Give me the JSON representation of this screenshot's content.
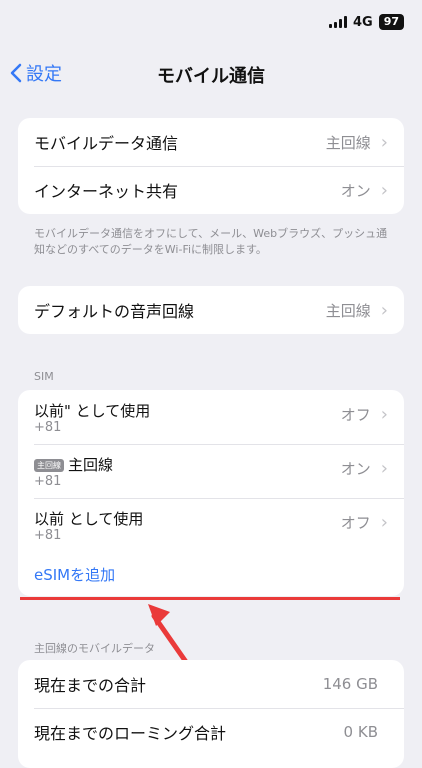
{
  "status": {
    "network": "4G",
    "battery": "97"
  },
  "nav": {
    "back_label": "設定",
    "title": "モバイル通信"
  },
  "group1": {
    "rows": [
      {
        "label": "モバイルデータ通信",
        "value": "主回線"
      },
      {
        "label": "インターネット共有",
        "value": "オン"
      }
    ],
    "note": "モバイルデータ通信をオフにして、メール、Webブラウズ、プッシュ通知などのすべてのデータをWi-Fiに制限します。"
  },
  "group2": {
    "label": "デフォルトの音声回線",
    "value": "主回線"
  },
  "sim": {
    "header": "SIM",
    "rows": [
      {
        "title": "以前\"                          として使用",
        "sub": "+81",
        "value": "オフ"
      },
      {
        "badge": "主回線",
        "title": "主回線",
        "sub": "+81",
        "value": "オン"
      },
      {
        "title": "以前          として使用",
        "sub": "+81",
        "value": "オフ"
      }
    ],
    "add_esim": "eSIMを追加"
  },
  "usage": {
    "header": "主回線のモバイルデータ",
    "rows": [
      {
        "label": "現在までの合計",
        "value": "146 GB"
      },
      {
        "label": "現在までのローミング合計",
        "value": "0 KB"
      }
    ]
  },
  "colors": {
    "accent": "#3478f6",
    "annotation": "#ea3a3a"
  }
}
